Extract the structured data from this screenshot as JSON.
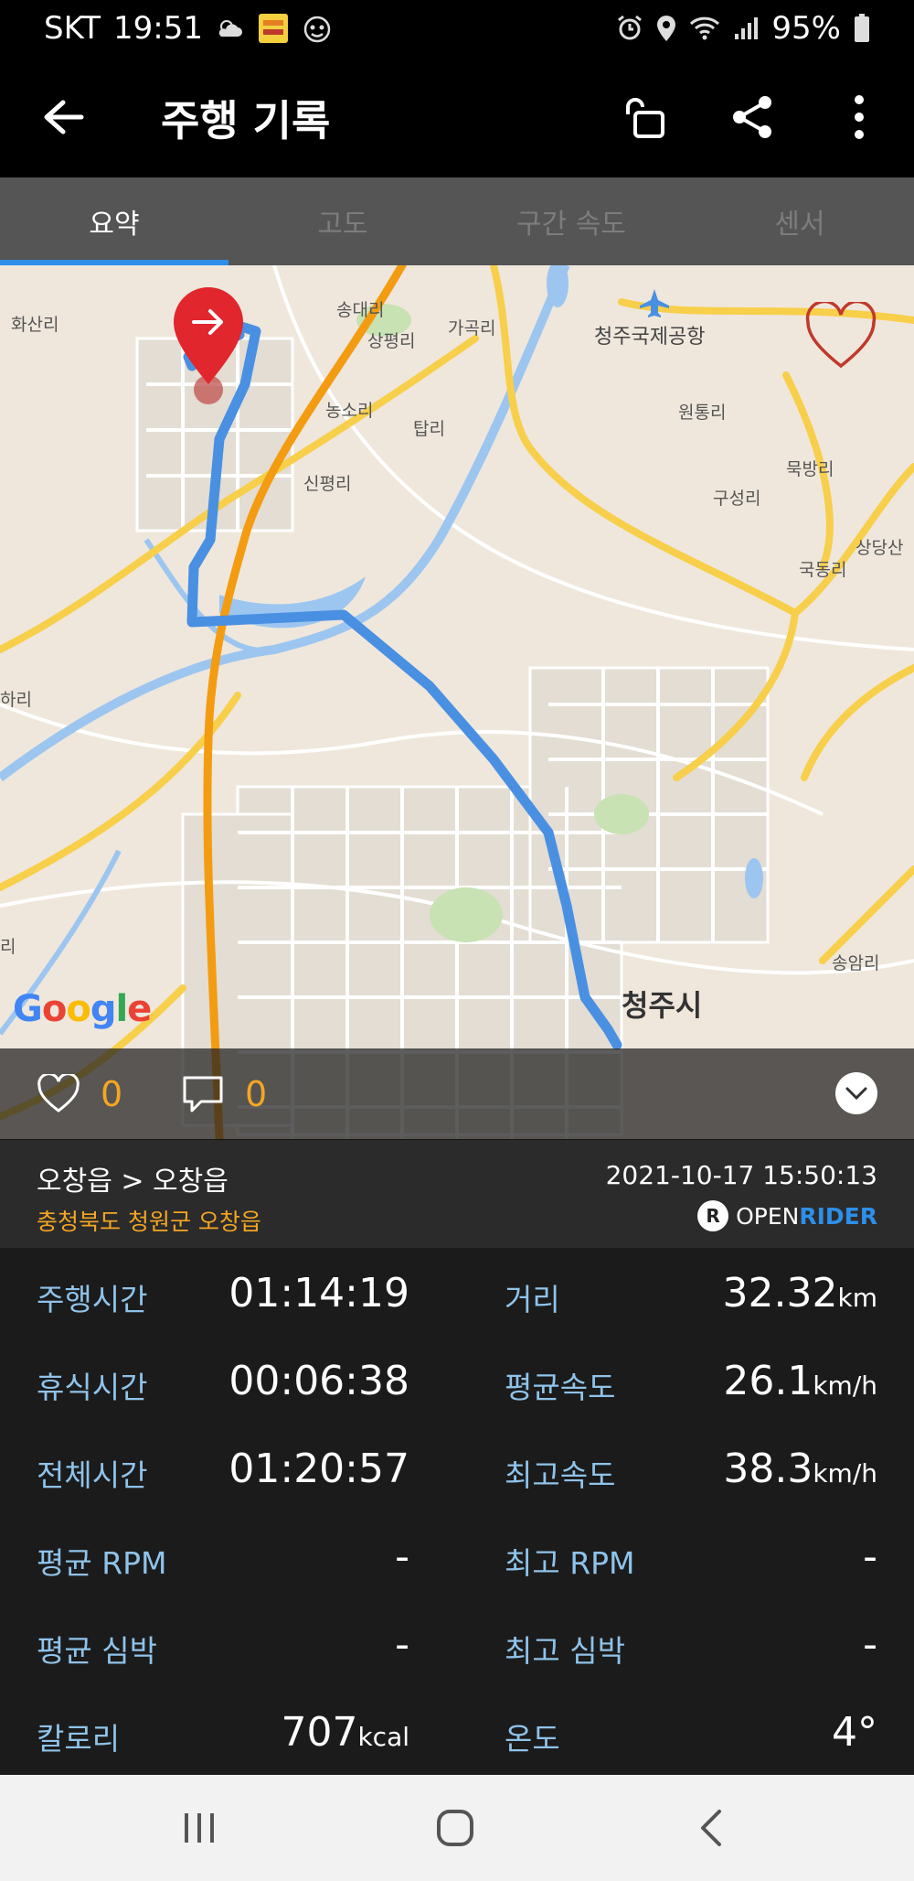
{
  "status_bar": {
    "carrier": "SKT",
    "time": "19:51",
    "battery": "95%",
    "icons_left": [
      "weather-cloudy-icon",
      "app-notification-icon",
      "game-notification-icon"
    ],
    "icons_right": [
      "alarm-icon",
      "location-icon",
      "wifi-icon",
      "signal-icon",
      "battery-icon"
    ]
  },
  "app_bar": {
    "title": "주행 기록",
    "actions": [
      "back-icon",
      "unlock-icon",
      "share-icon",
      "more-icon"
    ]
  },
  "tabs": [
    {
      "label": "요약",
      "active": true
    },
    {
      "label": "고도",
      "active": false
    },
    {
      "label": "구간 속도",
      "active": false
    },
    {
      "label": "센서",
      "active": false
    }
  ],
  "map": {
    "labels": {
      "hwasanri": "화산리",
      "songdaeri": "송대리",
      "sangpyeongri": "상평리",
      "gagokri": "가곡리",
      "airport": "청주국제공항",
      "nongsori": "농소리",
      "tapri": "탑리",
      "wontongri": "원통리",
      "mukbangri": "묵방리",
      "gusungri": "구성리",
      "sinpyeongri": "신평리",
      "sangdang": "상당산",
      "gukdongri": "국동리",
      "hakri": "하리",
      "cheongju": "청주시",
      "ri_left": "리",
      "sapyeong": "송암리"
    },
    "attribution": "Google",
    "accent_route": "#4a90e2"
  },
  "social": {
    "likes": "0",
    "comments": "0"
  },
  "route": {
    "name": "오창읍 > 오창읍",
    "region": "충청북도 청원군 오창읍",
    "datetime": "2021-10-17 15:50:13",
    "brand_open": "OPEN",
    "brand_rider": "RIDER"
  },
  "stats": {
    "left": [
      {
        "label": "주행시간",
        "value": "01:14:19",
        "unit": ""
      },
      {
        "label": "휴식시간",
        "value": "00:06:38",
        "unit": ""
      },
      {
        "label": "전체시간",
        "value": "01:20:57",
        "unit": ""
      },
      {
        "label": "평균 RPM",
        "value": "-",
        "unit": ""
      },
      {
        "label": "평균 심박",
        "value": "-",
        "unit": ""
      },
      {
        "label": "칼로리",
        "value": "707",
        "unit": "kcal"
      }
    ],
    "right": [
      {
        "label": "거리",
        "value": "32.32",
        "unit": "km"
      },
      {
        "label": "평균속도",
        "value": "26.1",
        "unit": "km/h"
      },
      {
        "label": "최고속도",
        "value": "38.3",
        "unit": "km/h"
      },
      {
        "label": "최고 RPM",
        "value": "-",
        "unit": ""
      },
      {
        "label": "최고 심박",
        "value": "-",
        "unit": ""
      },
      {
        "label": "온도",
        "value": "4°",
        "unit": ""
      }
    ]
  },
  "nav": [
    "recent-apps-icon",
    "home-icon",
    "back-nav-icon"
  ]
}
